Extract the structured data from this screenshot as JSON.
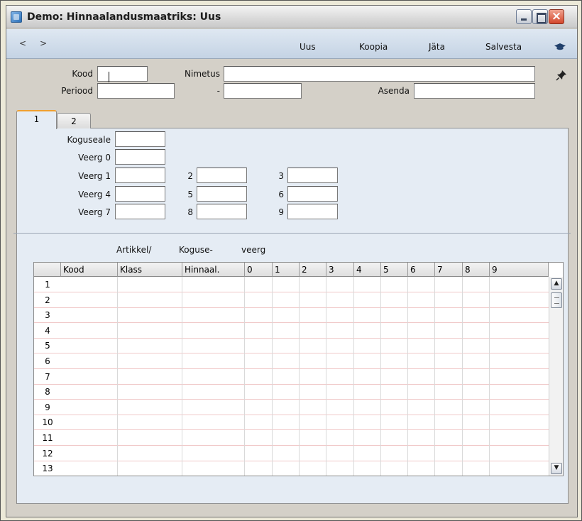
{
  "window": {
    "title": "Demo: Hinnaalandusmaatriks: Uus"
  },
  "nav": {
    "back": "<",
    "forward": ">"
  },
  "toolbar": {
    "new": "Uus",
    "copy": "Koopia",
    "discard": "Jäta",
    "save": "Salvesta"
  },
  "header": {
    "code_label": "Kood",
    "code_value": "",
    "name_label": "Nimetus",
    "name_value": "",
    "period_label": "Periood",
    "period_from": "",
    "period_sep": "-",
    "period_to": "",
    "replace_label": "Asenda",
    "replace_value": ""
  },
  "tabs": [
    "1",
    "2"
  ],
  "qty": {
    "area_label": "Koguseale",
    "col0_label": "Veerg 0",
    "col1_label": "Veerg 1",
    "col2_label": "2",
    "col3_label": "3",
    "col4_label": "Veerg 4",
    "col5_label": "5",
    "col6_label": "6",
    "col7_label": "Veerg 7",
    "col8_label": "8",
    "col9_label": "9"
  },
  "grid": {
    "super_headers": {
      "artikkel": "Artikkel/",
      "koguse": "Koguse-",
      "veerg": "veerg"
    },
    "columns": [
      "Kood",
      "Klass",
      "Hinnaal.",
      "0",
      "1",
      "2",
      "3",
      "4",
      "5",
      "6",
      "7",
      "8",
      "9"
    ],
    "rows": [
      "1",
      "2",
      "3",
      "4",
      "5",
      "6",
      "7",
      "8",
      "9",
      "10",
      "11",
      "12",
      "13"
    ]
  }
}
